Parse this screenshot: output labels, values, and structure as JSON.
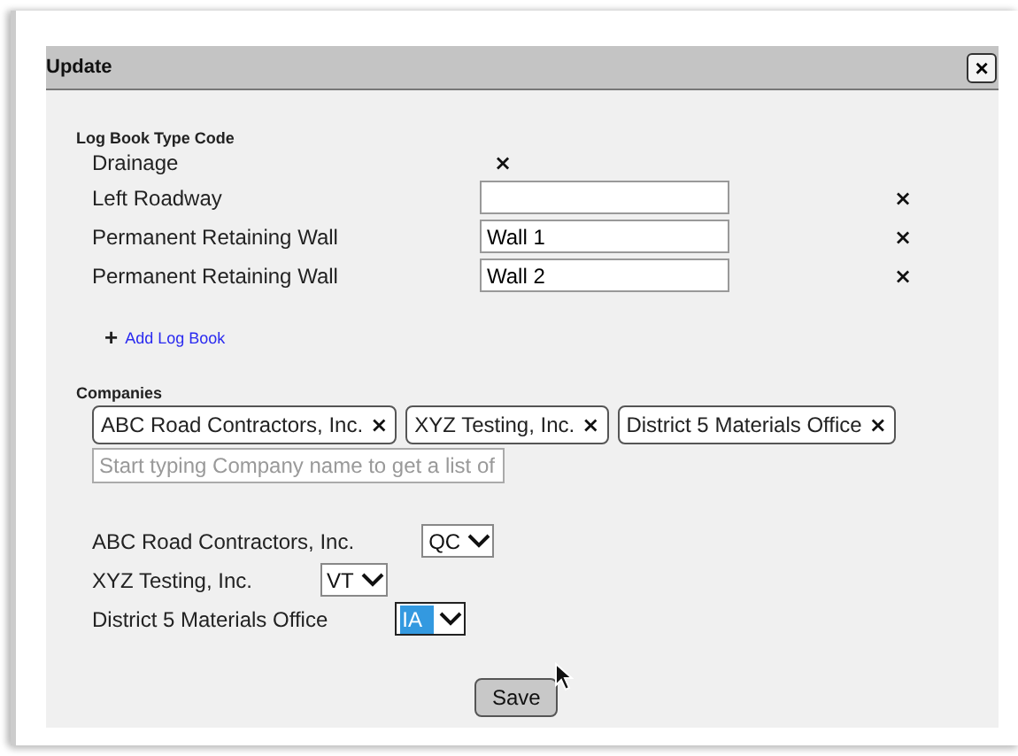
{
  "dialog": {
    "title": "Update",
    "close_label": "×"
  },
  "log_books": {
    "label": "Log Book Type Code",
    "rows": [
      {
        "kind": "text",
        "name": "Drainage",
        "remove": "×"
      },
      {
        "kind": "input",
        "name": "Left Roadway",
        "value": "",
        "remove": "×"
      },
      {
        "kind": "input",
        "name": "Permanent Retaining Wall",
        "value": "Wall 1",
        "remove": "×"
      },
      {
        "kind": "input",
        "name": "Permanent Retaining Wall",
        "value": "Wall 2",
        "remove": "×"
      }
    ],
    "add_link": {
      "icon": "+",
      "label": "Add Log Book"
    }
  },
  "companies": {
    "label": "Companies",
    "tags": [
      {
        "label": "ABC Road Contractors, Inc.",
        "remove": "×"
      },
      {
        "label": "XYZ Testing, Inc.",
        "remove": "×"
      },
      {
        "label": "District 5 Materials Office",
        "remove": "×"
      }
    ],
    "search": {
      "placeholder": "Start typing Company name to get a list of"
    },
    "roles": [
      {
        "company": "ABC Road Contractors, Inc.",
        "value": "QC",
        "focused": false
      },
      {
        "company": "XYZ Testing, Inc.",
        "value": "VT",
        "focused": false
      },
      {
        "company": "District 5 Materials Office",
        "value": "IA",
        "focused": true
      }
    ]
  },
  "save_button": "Save"
}
